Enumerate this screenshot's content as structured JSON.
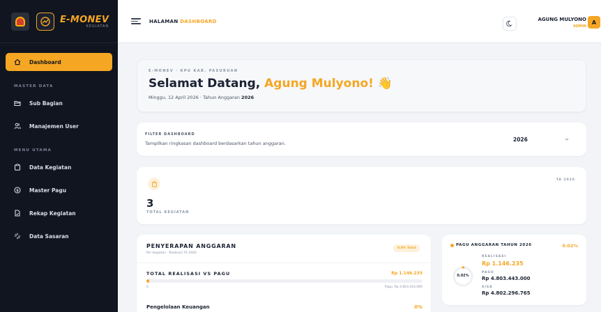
{
  "brand": {
    "title": "E-MONEV",
    "subtitle": "KEGIATAN"
  },
  "sidebar": {
    "items": [
      {
        "label": "Dashboard",
        "icon": "home-icon",
        "active": true
      },
      {
        "section": "MASTER DATA"
      },
      {
        "label": "Sub Bagian",
        "icon": "folder-icon"
      },
      {
        "label": "Manajemen User",
        "icon": "users-icon"
      },
      {
        "section": "MENU UTAMA"
      },
      {
        "label": "Data Kegiatan",
        "icon": "clipboard-icon"
      },
      {
        "label": "Master Pagu",
        "icon": "dollar-circle-icon"
      },
      {
        "label": "Rekap Kegiatan",
        "icon": "file-icon"
      },
      {
        "label": "Data Sasaran",
        "icon": "crosshair-icon"
      }
    ]
  },
  "header": {
    "title_part1": "HALAMAN",
    "title_part2": "DASHBOARD",
    "user_name": "AGUNG MULYONO",
    "user_role": "ADMIN",
    "avatar_initial": "A"
  },
  "welcome": {
    "eyebrow": "E-MONEV · KPU KAB. PASURUAN",
    "greeting": "Selamat Datang,",
    "name": "Agung Mulyono!",
    "wave": "👋",
    "date": "Minggu, 12 April 2026",
    "separator": "·",
    "year_label": "Tahun Anggaran",
    "year": "2026"
  },
  "filter": {
    "label": "FILTER DASHBOARD",
    "description": "Tampilkan ringkasan dashboard berdasarkan tahun anggaran.",
    "selected_year": "2026"
  },
  "stat": {
    "ta_badge": "TA 2026",
    "value": "3",
    "label": "TOTAL KEGIATAN"
  },
  "absorption": {
    "title": "PENYERAPAN ANGGARAN",
    "subtitle": "Per kegiatan · Realisasi TA 2026",
    "pill": "0.0% Total",
    "total_label": "TOTAL REALISASI VS PAGU",
    "total_amount": "Rp 1.146.235",
    "progress_fraction": 0.0002,
    "zero_label": "0",
    "pagu_label": "Pagu: Rp 4.803.443.000",
    "first_row_name": "Pengelolaan Keuangan",
    "first_row_pct": "0%"
  },
  "pagu": {
    "title": "PAGU ANGGARAN TAHUN 2026",
    "percent": "0.02%",
    "ring_label": "0.02%",
    "ring_fraction": 0.0002,
    "realisasi_label": "REALISASI",
    "realisasi_value": "Rp 1.146.235",
    "pagu_label": "PAGU",
    "pagu_value": "Rp 4.803.443.000",
    "sisa_label": "SISA",
    "sisa_value": "Rp 4.802.296.765"
  },
  "colors": {
    "accent": "#f5a623",
    "sidebar_bg": "#10151f",
    "page_bg": "#f2f4f7"
  }
}
